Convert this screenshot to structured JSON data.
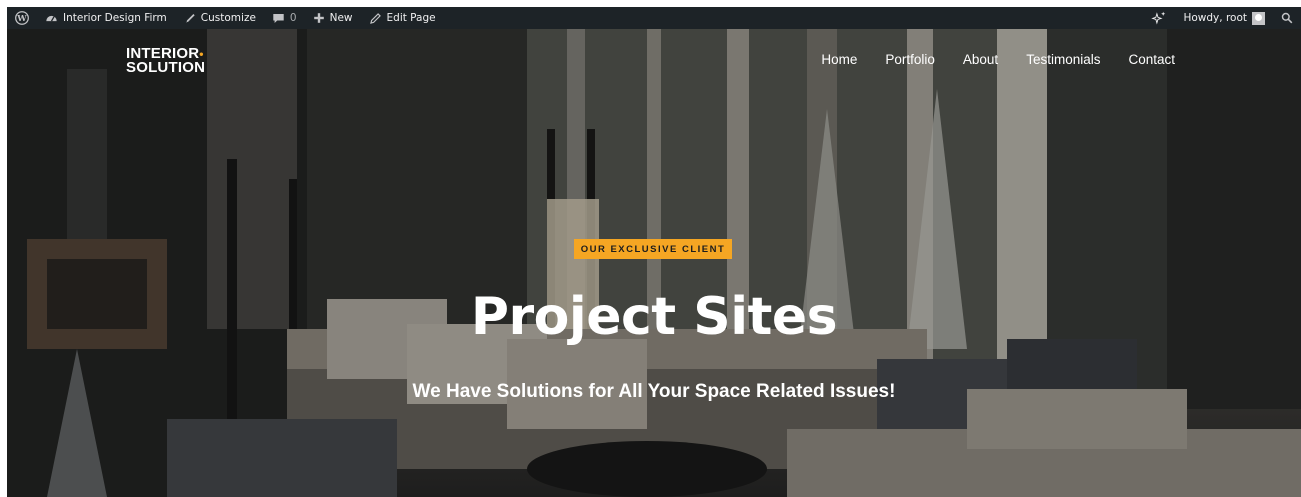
{
  "adminbar": {
    "wp_logo_icon": "wordpress-logo-icon",
    "site_name": "Interior Design Firm",
    "customize": "Customize",
    "comments_count": "0",
    "new_label": "New",
    "edit_page": "Edit Page",
    "howdy": "Howdy, root",
    "colors": {
      "background": "#1d2327",
      "text": "#f0f0f1"
    }
  },
  "header": {
    "logo_line1": "INTERIOR",
    "logo_dot": "•",
    "logo_line2": "SOLUTION",
    "nav": [
      "Home",
      "Portfolio",
      "About",
      "Testimonials",
      "Contact"
    ]
  },
  "hero": {
    "badge": "OUR EXCLUSIVE CLIENT",
    "title": "Project Sites",
    "subtitle": "We Have Solutions for All Your Space Related Issues!",
    "colors": {
      "accent": "#f5a623"
    }
  }
}
